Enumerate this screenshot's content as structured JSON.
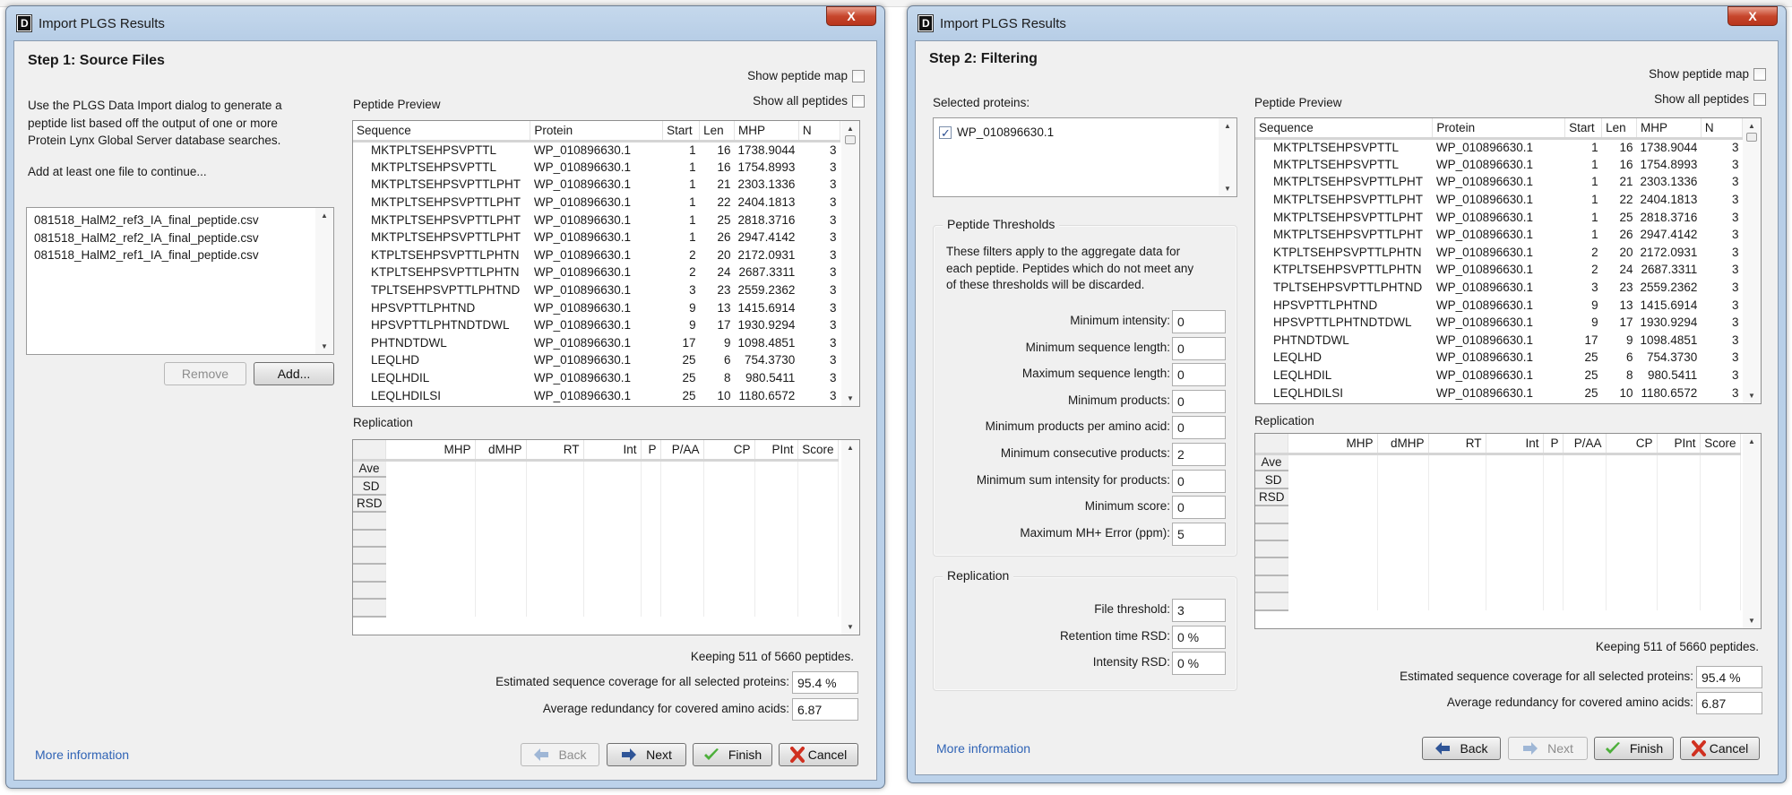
{
  "window_title": "Import PLGS Results",
  "close_label": "X",
  "colors": {
    "link": "#2f63b5",
    "title_bar": "#b6cde6",
    "close": "#c7472d",
    "panel": "#f0f0f0"
  },
  "peptide_preview": {
    "label": "Peptide Preview",
    "show_peptide_map": "Show peptide map",
    "show_all_peptides": "Show all peptides",
    "columns": [
      "Sequence",
      "Protein",
      "Start",
      "Len",
      "MHP",
      "N"
    ],
    "rows": [
      [
        "MKTPLTSEHPSVPTTL",
        "WP_010896630.1",
        "1",
        "16",
        "1738.9044",
        "3"
      ],
      [
        "MKTPLTSEHPSVPTTL",
        "WP_010896630.1",
        "1",
        "16",
        "1754.8993",
        "3"
      ],
      [
        "MKTPLTSEHPSVPTTLPHT",
        "WP_010896630.1",
        "1",
        "21",
        "2303.1336",
        "3"
      ],
      [
        "MKTPLTSEHPSVPTTLPHT",
        "WP_010896630.1",
        "1",
        "22",
        "2404.1813",
        "3"
      ],
      [
        "MKTPLTSEHPSVPTTLPHT",
        "WP_010896630.1",
        "1",
        "25",
        "2818.3716",
        "3"
      ],
      [
        "MKTPLTSEHPSVPTTLPHT",
        "WP_010896630.1",
        "1",
        "26",
        "2947.4142",
        "3"
      ],
      [
        "KTPLTSEHPSVPTTLPHTN",
        "WP_010896630.1",
        "2",
        "20",
        "2172.0931",
        "3"
      ],
      [
        "KTPLTSEHPSVPTTLPHTN",
        "WP_010896630.1",
        "2",
        "24",
        "2687.3311",
        "3"
      ],
      [
        "TPLTSEHPSVPTTLPHTND",
        "WP_010896630.1",
        "3",
        "23",
        "2559.2362",
        "3"
      ],
      [
        "HPSVPTTLPHTND",
        "WP_010896630.1",
        "9",
        "13",
        "1415.6914",
        "3"
      ],
      [
        "HPSVPTTLPHTNDTDWL",
        "WP_010896630.1",
        "9",
        "17",
        "1930.9294",
        "3"
      ],
      [
        "PHTNDTDWL",
        "WP_010896630.1",
        "17",
        "9",
        "1098.4851",
        "3"
      ],
      [
        "LEQLHD",
        "WP_010896630.1",
        "25",
        "6",
        "754.3730",
        "3"
      ],
      [
        "LEQLHDIL",
        "WP_010896630.1",
        "25",
        "8",
        "980.5411",
        "3"
      ],
      [
        "LEQLHDILSI",
        "WP_010896630.1",
        "25",
        "10",
        "1180.6572",
        "3"
      ]
    ]
  },
  "replication_table": {
    "label": "Replication",
    "columns": [
      "MHP",
      "dMHP",
      "RT",
      "Int",
      "P",
      "P/AA",
      "CP",
      "PInt",
      "Score"
    ],
    "row_headers": [
      "Ave",
      "SD",
      "RSD",
      "",
      "",
      "",
      "",
      "",
      ""
    ]
  },
  "summary": {
    "keeping": "Keeping 511 of 5660 peptides.",
    "coverage_label": "Estimated sequence coverage for all selected proteins:",
    "coverage_value": "95.4 %",
    "redundancy_label": "Average redundancy for covered amino acids:",
    "redundancy_value": "6.87"
  },
  "footer": {
    "more_info": "More information",
    "back": "Back",
    "next": "Next",
    "finish": "Finish",
    "cancel": "Cancel"
  },
  "step1": {
    "title": "Step 1: Source Files",
    "description_lines": [
      "Use the PLGS Data Import dialog to generate a",
      "peptide list based off the output of one or more",
      "Protein Lynx Global Server database searches."
    ],
    "hint": "Add at least one file to continue...",
    "files": [
      "081518_HalM2_ref3_IA_final_peptide.csv",
      "081518_HalM2_ref2_IA_final_peptide.csv",
      "081518_HalM2_ref1_IA_final_peptide.csv"
    ],
    "remove": "Remove",
    "add": "Add..."
  },
  "step2": {
    "title": "Step 2: Filtering",
    "selected_proteins_label": "Selected proteins:",
    "proteins": [
      {
        "name": "WP_010896630.1",
        "checked": true
      }
    ],
    "thresholds": {
      "legend": "Peptide Thresholds",
      "description_lines": [
        "These filters apply to the aggregate data for",
        "each peptide. Peptides which do not meet any",
        "of these thresholds will be discarded."
      ],
      "rows": [
        {
          "label": "Minimum intensity:",
          "value": "0"
        },
        {
          "label": "Minimum sequence length:",
          "value": "0"
        },
        {
          "label": "Maximum sequence length:",
          "value": "0"
        },
        {
          "label": "Minimum products:",
          "value": "0"
        },
        {
          "label": "Minimum products per amino acid:",
          "value": "0"
        },
        {
          "label": "Minimum consecutive products:",
          "value": "2"
        },
        {
          "label": "Minimum sum intensity for products:",
          "value": "0"
        },
        {
          "label": "Minimum score:",
          "value": "0"
        },
        {
          "label": "Maximum MH+ Error (ppm):",
          "value": "5"
        }
      ]
    },
    "replication": {
      "legend": "Replication",
      "rows": [
        {
          "label": "File threshold:",
          "value": "3"
        },
        {
          "label": "Retention time RSD:",
          "value": "0 %"
        },
        {
          "label": "Intensity RSD:",
          "value": "0 %"
        }
      ]
    }
  }
}
